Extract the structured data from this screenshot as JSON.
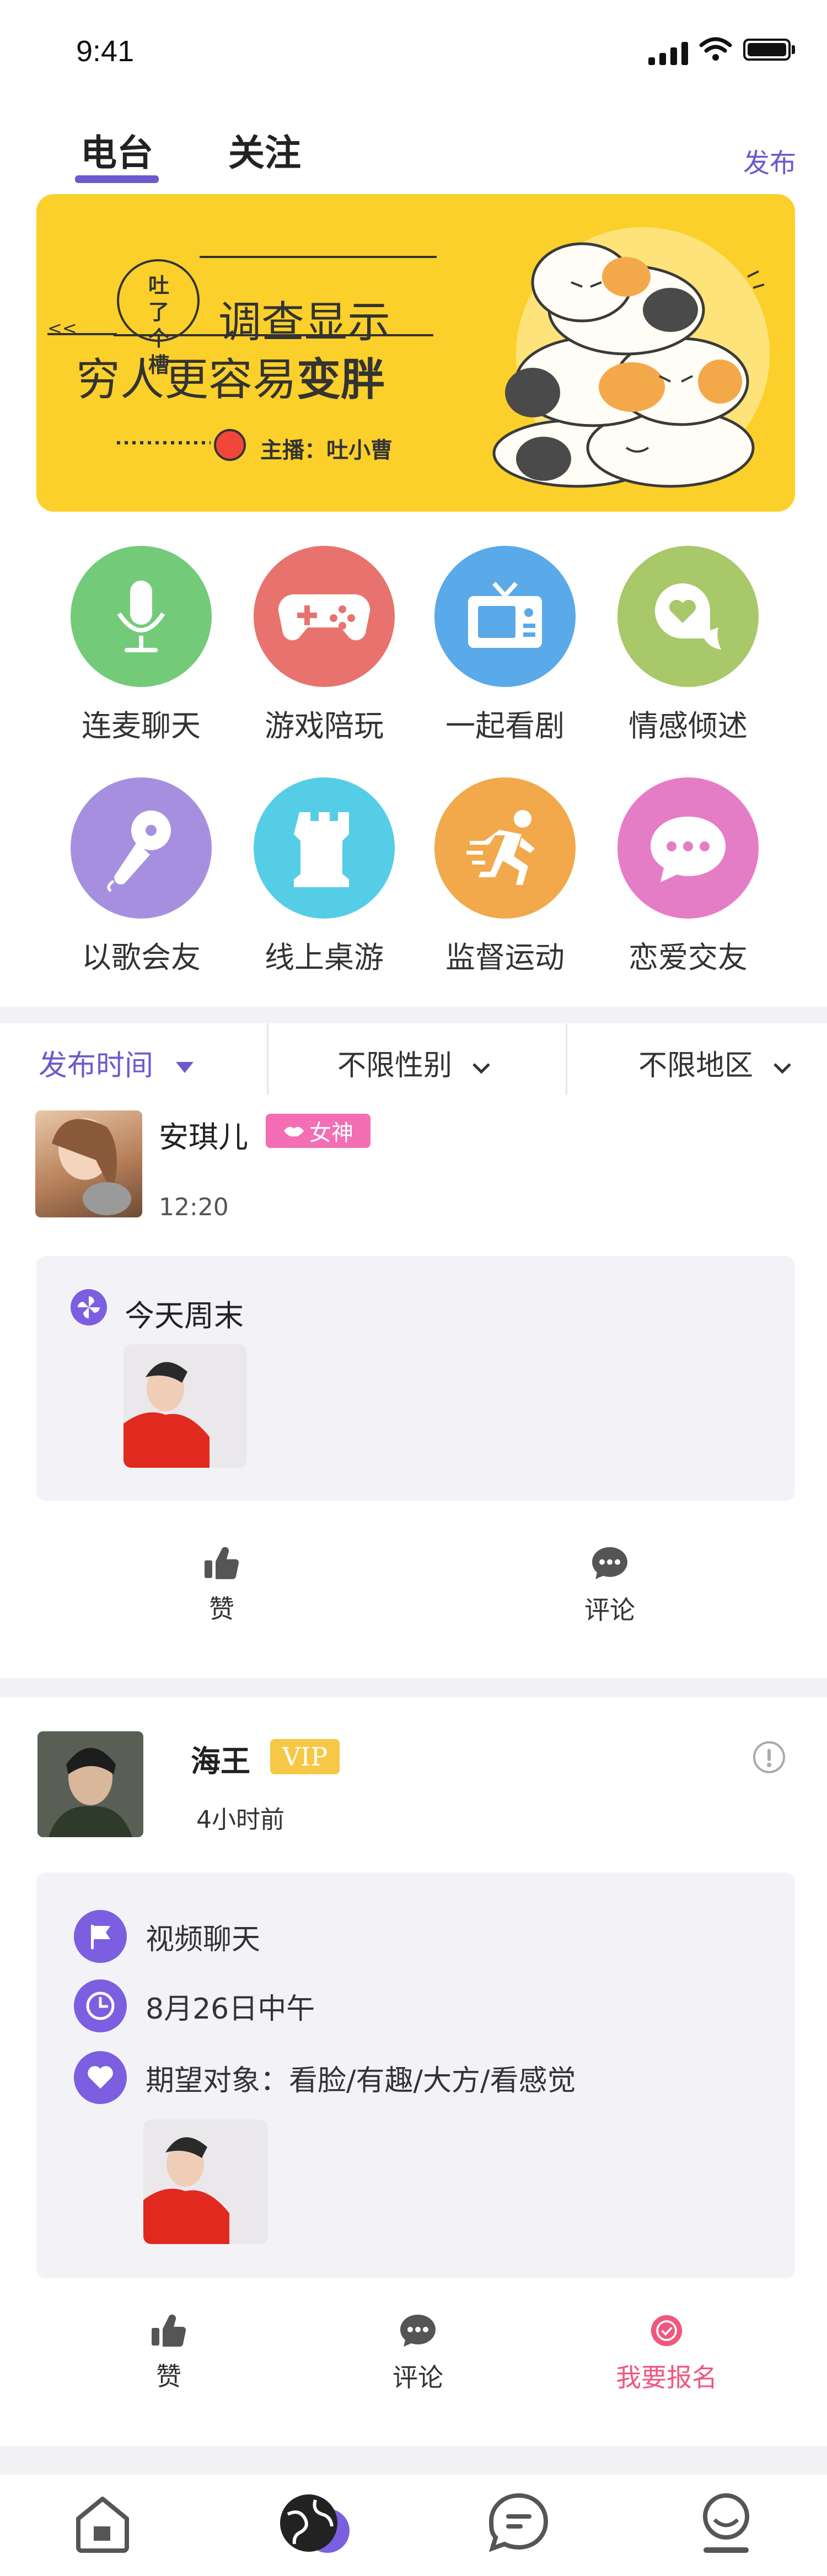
{
  "status_bar": {
    "time": "9:41"
  },
  "tabs": [
    {
      "label": "电台",
      "active": true
    },
    {
      "label": "关注",
      "active": false
    }
  ],
  "publish_label": "发布",
  "banner": {
    "badge_line1": "吐了",
    "badge_line2": "个槽",
    "title_line1": "调查显示",
    "title_line2_prefix": "穷人更容易",
    "title_line2_bold": "变胖",
    "host": "主播：吐小曹",
    "background": "#fcd02a"
  },
  "categories": [
    {
      "label": "连麦聊天",
      "icon": "microphone-icon",
      "color": "#73cb7a"
    },
    {
      "label": "游戏陪玩",
      "icon": "gamepad-icon",
      "color": "#e8736e"
    },
    {
      "label": "一起看剧",
      "icon": "tv-icon",
      "color": "#5aa9e8"
    },
    {
      "label": "情感倾述",
      "icon": "heart-chat-icon",
      "color": "#a8c86a"
    },
    {
      "label": "以歌会友",
      "icon": "karaoke-mic-icon",
      "color": "#a78fe0"
    },
    {
      "label": "线上桌游",
      "icon": "chess-rook-icon",
      "color": "#56cde6"
    },
    {
      "label": "监督运动",
      "icon": "running-icon",
      "color": "#f2a94b"
    },
    {
      "label": "恋爱交友",
      "icon": "chat-bubble-icon",
      "color": "#e47dc6"
    }
  ],
  "filters": {
    "time": "发布时间",
    "gender": "不限性别",
    "region": "不限地区"
  },
  "posts": [
    {
      "user": "安琪儿",
      "tag": "女神",
      "time": "12:20",
      "content": "今天周末",
      "actions": {
        "like": "赞",
        "comment": "评论"
      }
    },
    {
      "user": "海王",
      "tag": "VIP",
      "time": "4小时前",
      "activity": "视频聊天",
      "date": "8月26日中午",
      "expect": "期望对象：看脸/有趣/大方/看感觉",
      "actions": {
        "like": "赞",
        "comment": "评论",
        "signup": "我要报名"
      }
    }
  ],
  "colors": {
    "accent": "#6a5acd",
    "signup": "#f0577f"
  }
}
